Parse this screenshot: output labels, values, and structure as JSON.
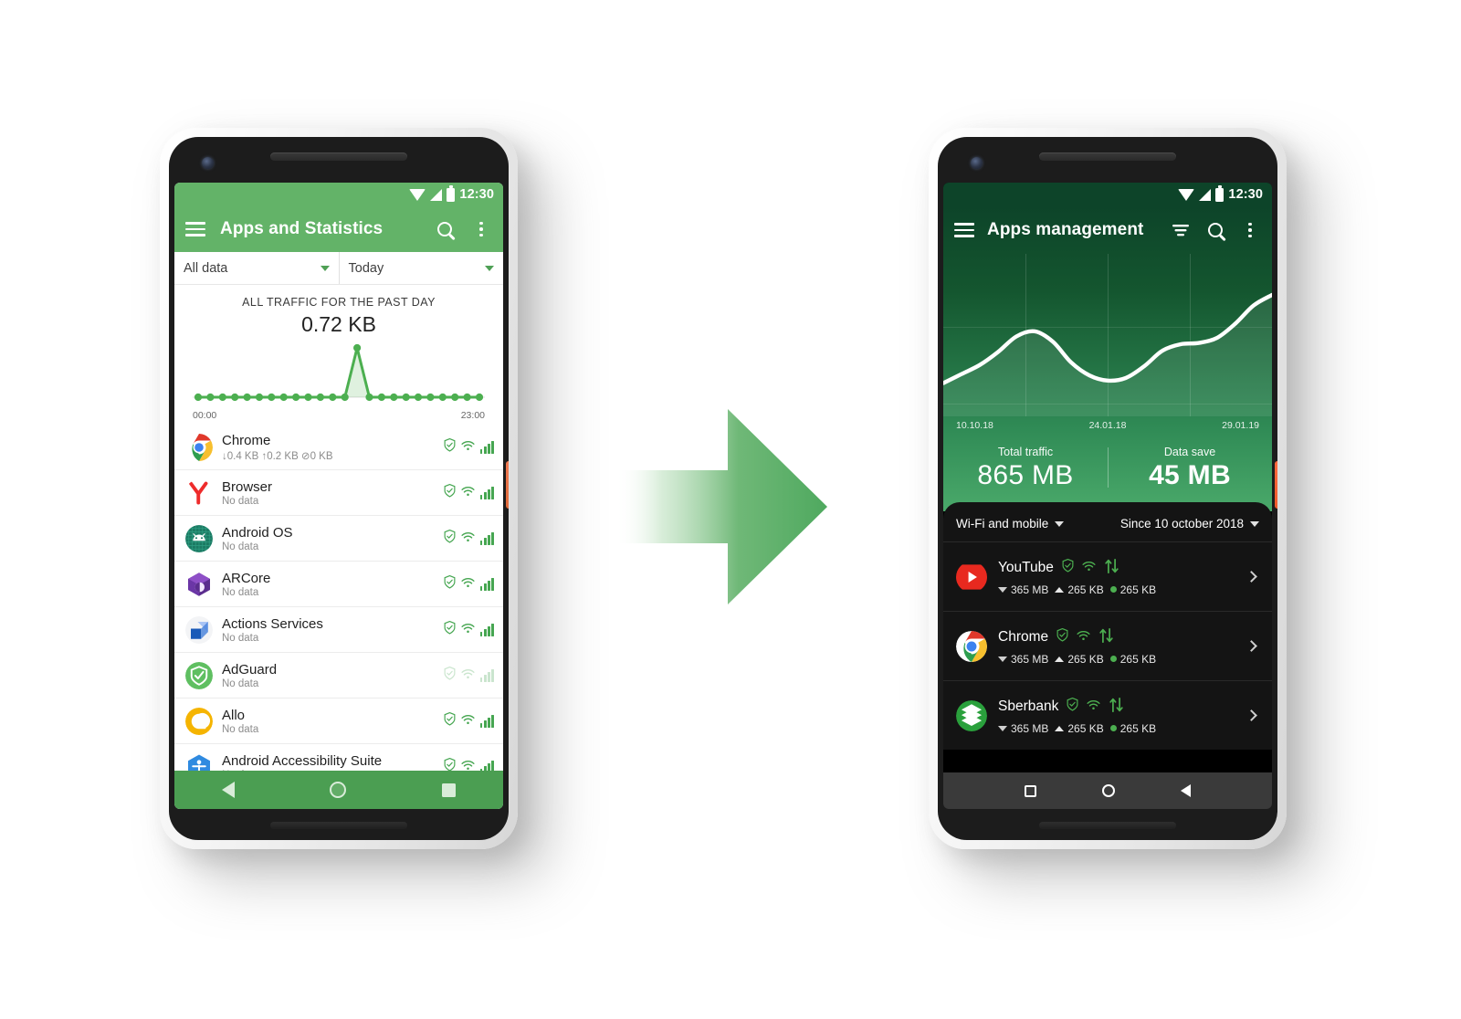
{
  "left_phone": {
    "status_bar": {
      "time": "12:30",
      "icons": [
        "wifi-icon",
        "signal-icon",
        "battery-icon"
      ]
    },
    "appbar": {
      "menu_icon": "hamburger-menu-icon",
      "title": "Apps and Statistics",
      "search_icon": "search-icon",
      "overflow_icon": "kebab-menu-icon"
    },
    "filters": [
      {
        "label": "All data",
        "caret": "chevron-down-icon"
      },
      {
        "label": "Today",
        "caret": "chevron-down-icon"
      }
    ],
    "chart_header": {
      "title": "ALL TRAFFIC FOR THE PAST DAY",
      "value": "0.72 KB"
    },
    "axis": {
      "start": "00:00",
      "end": "23:00"
    },
    "apps": [
      {
        "name": "Chrome",
        "sub": "↓0.4 KB ↑0.2 KB ⊘0 KB",
        "icon": "chrome-icon",
        "dimmed": false
      },
      {
        "name": "Browser",
        "sub": "No data",
        "icon": "yandex-browser-icon",
        "dimmed": false
      },
      {
        "name": "Android OS",
        "sub": "No data",
        "icon": "android-os-icon",
        "dimmed": false
      },
      {
        "name": "ARCore",
        "sub": "No data",
        "icon": "arcore-icon",
        "dimmed": false
      },
      {
        "name": "Actions Services",
        "sub": "No data",
        "icon": "actions-services-icon",
        "dimmed": false
      },
      {
        "name": "AdGuard",
        "sub": "No data",
        "icon": "adguard-icon",
        "dimmed": true
      },
      {
        "name": "Allo",
        "sub": "No data",
        "icon": "allo-icon",
        "dimmed": false
      },
      {
        "name": "Android Accessibility Suite",
        "sub": "No data",
        "icon": "accessibility-suite-icon",
        "dimmed": false
      }
    ],
    "row_badges": [
      "shield-icon",
      "wifi-icon",
      "signal-bars-icon"
    ],
    "navbar": [
      "back-button",
      "home-button",
      "recents-button"
    ]
  },
  "right_phone": {
    "status_bar": {
      "time": "12:30",
      "icons": [
        "wifi-icon",
        "signal-icon",
        "battery-icon"
      ]
    },
    "appbar": {
      "menu_icon": "hamburger-menu-icon",
      "title": "Apps management",
      "sort_icon": "sort-filter-icon",
      "search_icon": "search-icon",
      "overflow_icon": "kebab-menu-icon"
    },
    "dates": [
      "10.10.18",
      "24.01.18",
      "29.01.19"
    ],
    "totals": [
      {
        "label": "Total traffic",
        "value": "865 MB"
      },
      {
        "label": "Data save",
        "value": "45 MB"
      }
    ],
    "filters": [
      {
        "label": "Wi-Fi and mobile",
        "caret": "chevron-down-icon"
      },
      {
        "label": "Since 10 october 2018",
        "caret": "chevron-down-icon"
      }
    ],
    "apps": [
      {
        "name": "YouTube",
        "icon": "youtube-icon",
        "down": "365 MB",
        "up": "265 KB",
        "saved": "265 KB"
      },
      {
        "name": "Chrome",
        "icon": "chrome-icon",
        "down": "365 MB",
        "up": "265 KB",
        "saved": "265 KB"
      },
      {
        "name": "Sberbank",
        "icon": "sberbank-icon",
        "down": "365 MB",
        "up": "265 KB",
        "saved": "265 KB"
      }
    ],
    "row_badges": [
      "shield-icon",
      "wifi-icon",
      "transfer-arrows-icon"
    ],
    "row_chevron": "chevron-right-icon",
    "navbar": [
      "recents-button",
      "home-button",
      "back-button"
    ]
  },
  "arrow": {
    "name": "right-arrow",
    "color": "#5fb16a"
  },
  "colors": {
    "green_primary": "#63b368",
    "green_nav": "#4b9e52",
    "dark_green": "#0d4429",
    "mid_green": "#2f8a55",
    "panel_dark": "#141414",
    "accent_green": "#4caf50"
  },
  "chart_data": [
    {
      "type": "line",
      "id": "left-sparkline",
      "title": "ALL TRAFFIC FOR THE PAST DAY",
      "total_label": "0.72 KB",
      "xlabel": "",
      "ylabel": "",
      "x": [
        "00:00",
        "01:00",
        "02:00",
        "03:00",
        "04:00",
        "05:00",
        "06:00",
        "07:00",
        "08:00",
        "09:00",
        "10:00",
        "11:00",
        "12:00",
        "13:00",
        "14:00",
        "15:00",
        "16:00",
        "17:00",
        "18:00",
        "19:00",
        "20:00",
        "21:00",
        "22:00",
        "23:00"
      ],
      "values": [
        0,
        0,
        0,
        0,
        0,
        0,
        0,
        0,
        0,
        0,
        0,
        0,
        0,
        0.72,
        0,
        0,
        0,
        0,
        0,
        0,
        0,
        0,
        0,
        0
      ],
      "tick_labels": [
        "00:00",
        "23:00"
      ],
      "ylim": [
        0,
        0.8
      ],
      "grid": false,
      "markers": true,
      "line_color": "#4caf50",
      "fill_color": "rgba(76,175,80,0.18)"
    },
    {
      "type": "area",
      "id": "right-hero-chart",
      "title": "",
      "x": [
        "10.10.18",
        "24.01.18",
        "29.01.19"
      ],
      "tick_labels": [
        "10.10.18",
        "24.01.18",
        "29.01.19"
      ],
      "values": [
        20,
        27,
        34,
        44,
        56,
        60,
        52,
        36,
        26,
        22,
        24,
        33,
        45,
        50,
        51,
        55,
        66,
        80,
        88
      ],
      "ylim": [
        0,
        100
      ],
      "grid": true,
      "line_color": "#ffffff",
      "fill_color": "rgba(255,255,255,0.10)"
    }
  ]
}
